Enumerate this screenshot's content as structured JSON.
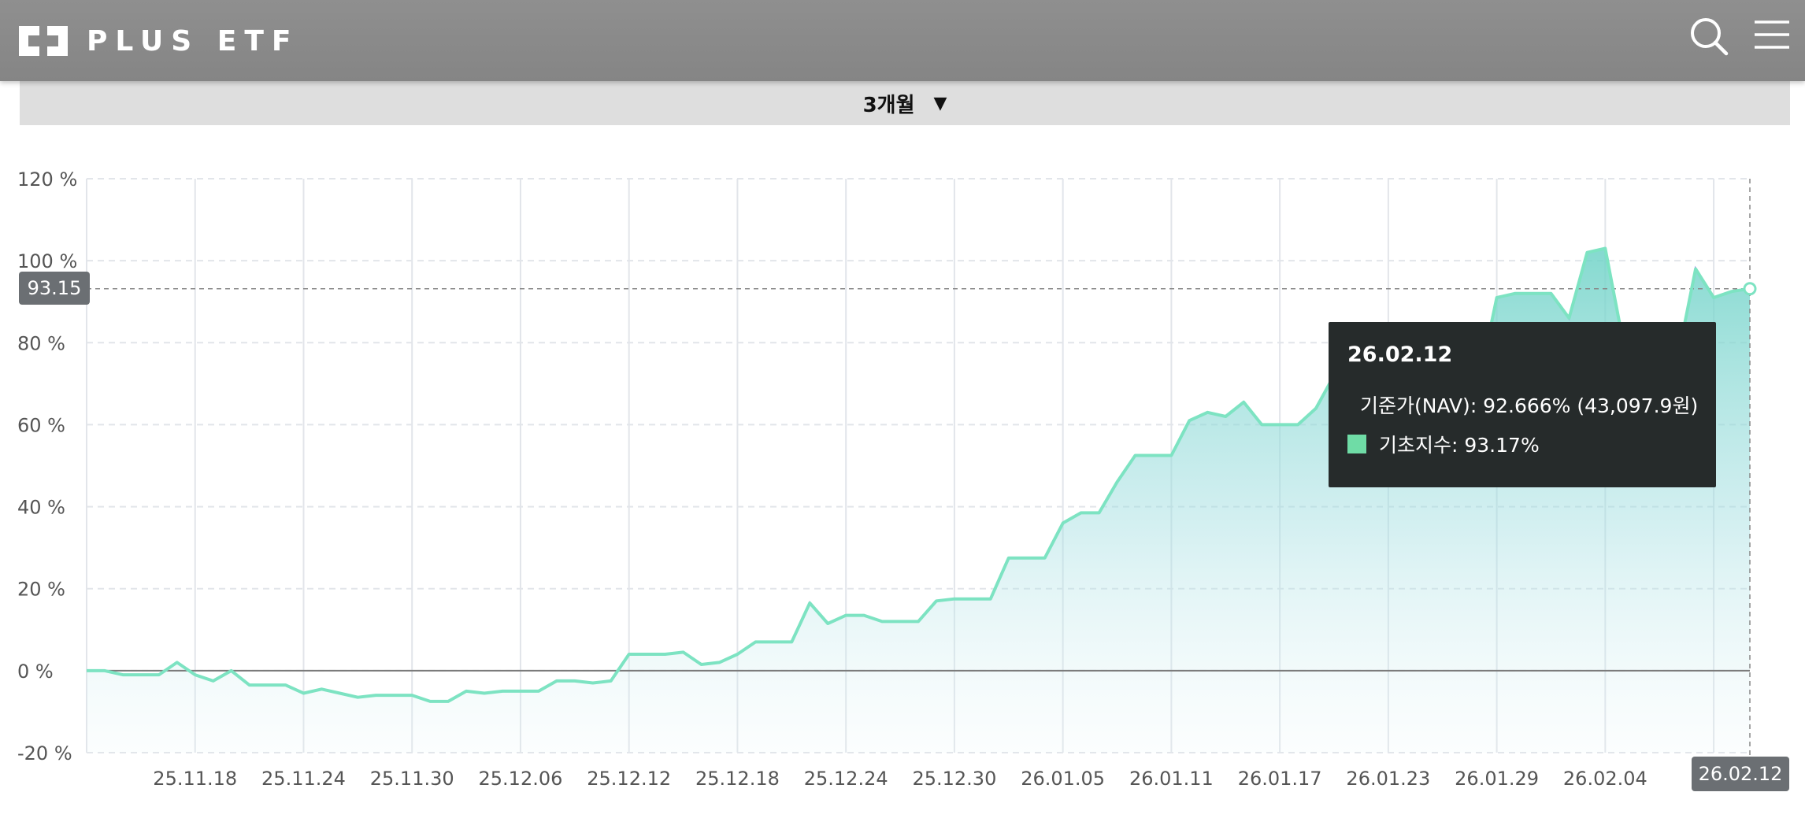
{
  "header": {
    "brand": "PLUS ETF",
    "search_icon": "search-icon",
    "menu_icon": "hamburger-menu-icon"
  },
  "period": {
    "label": "3개월",
    "arrow": "▼"
  },
  "tooltip": {
    "date": "26.02.12",
    "rows": [
      {
        "label": "기준가(NAV): 92.666% (43,097.9원)",
        "color": "#9b8fe8"
      },
      {
        "label": "기초지수: 93.17%",
        "color": "#6fdca6"
      }
    ]
  },
  "crosshair": {
    "y_value_label": "93.15",
    "x_value_label": "26.02.12"
  },
  "colors": {
    "line": "#7de3c2",
    "nav_line": "#9b8fe8",
    "fill_top": "#6fd3c7",
    "grid": "#e2e5ea",
    "axis_text": "#555555"
  },
  "chart_data": {
    "type": "area",
    "ylim": [
      -20,
      120
    ],
    "yticks": [
      120,
      100,
      80,
      60,
      40,
      20,
      0,
      -20
    ],
    "ytick_labels": [
      "120 %",
      "100 %",
      "80 %",
      "60 %",
      "40 %",
      "20 %",
      "0 %",
      "-20 %"
    ],
    "xtick_labels": [
      "25.11.18",
      "25.11.24",
      "25.11.30",
      "25.12.06",
      "25.12.12",
      "25.12.18",
      "25.12.24",
      "25.12.30",
      "26.01.05",
      "26.01.11",
      "26.01.17",
      "26.01.23",
      "26.01.29",
      "26.02.04",
      "26.0"
    ],
    "series": [
      {
        "name": "기초지수",
        "values": [
          0,
          0,
          -1,
          -1,
          -1,
          2,
          -1,
          -2.5,
          0,
          -3.5,
          -3.5,
          -3.5,
          -5.5,
          -4.5,
          -5.5,
          -6.5,
          -6,
          -6,
          -6,
          -7.5,
          -7.5,
          -5,
          -5.5,
          -5,
          -5,
          -5,
          -2.5,
          -2.5,
          -3,
          -2.5,
          4,
          4,
          4,
          4.5,
          1.5,
          2,
          4,
          7,
          7,
          7,
          16.5,
          11.5,
          13.5,
          13.5,
          12,
          12,
          12,
          17,
          17.5,
          17.5,
          17.5,
          27.5,
          27.5,
          27.5,
          36,
          38.5,
          38.5,
          46,
          52.5,
          52.5,
          52.5,
          61,
          63,
          62,
          65.5,
          60,
          60,
          60,
          64,
          72,
          75,
          71,
          76,
          71,
          68,
          65,
          63,
          70,
          91,
          92,
          92,
          92,
          86,
          102,
          103,
          80,
          72,
          72,
          76,
          98,
          91,
          92.5,
          93.17
        ]
      }
    ]
  }
}
